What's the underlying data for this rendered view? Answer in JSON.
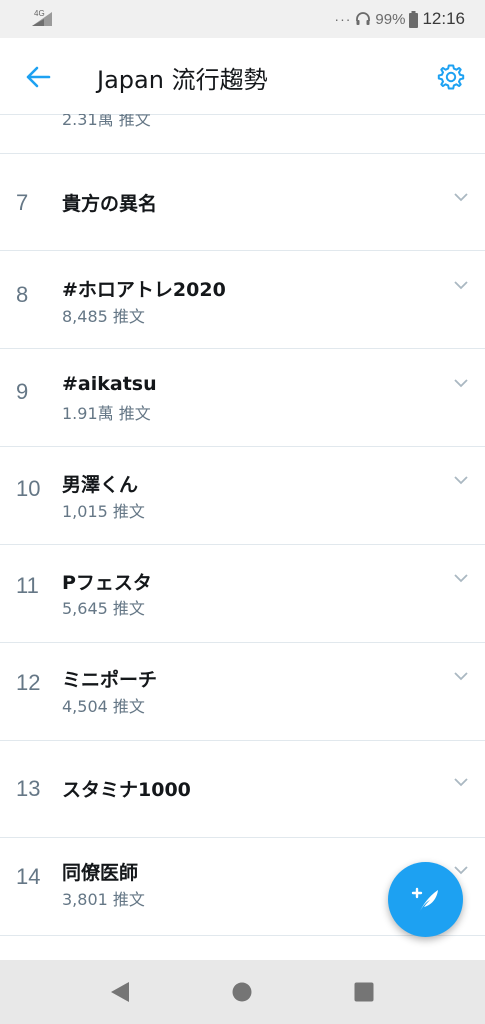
{
  "status_bar": {
    "network": "4G",
    "battery": "99%",
    "time": "12:16"
  },
  "header": {
    "title": "Japan 流行趨勢",
    "back_icon": "arrow-left-icon",
    "settings_icon": "gear-icon"
  },
  "colors": {
    "accent": "#1da1f2",
    "muted": "#657786",
    "text": "#14171a",
    "divider": "#e1e8ed"
  },
  "partial_trend": {
    "count": "2.31萬 推文"
  },
  "trends": [
    {
      "rank": "7",
      "name": "貴方の異名",
      "count": ""
    },
    {
      "rank": "8",
      "name": "#ホロアトレ2020",
      "count": "8,485 推文"
    },
    {
      "rank": "9",
      "name": "#aikatsu",
      "count": "1.91萬 推文"
    },
    {
      "rank": "10",
      "name": "男澤くん",
      "count": "1,015 推文"
    },
    {
      "rank": "11",
      "name": "Pフェスタ",
      "count": "5,645 推文"
    },
    {
      "rank": "12",
      "name": "ミニポーチ",
      "count": "4,504 推文"
    },
    {
      "rank": "13",
      "name": "スタミナ1000",
      "count": ""
    },
    {
      "rank": "14",
      "name": "同僚医師",
      "count": "3,801 推文"
    }
  ],
  "fab": {
    "icon": "compose-tweet-icon"
  },
  "nav": {
    "back_icon": "triangle-back-icon",
    "home_icon": "circle-home-icon",
    "recents_icon": "square-recents-icon"
  }
}
